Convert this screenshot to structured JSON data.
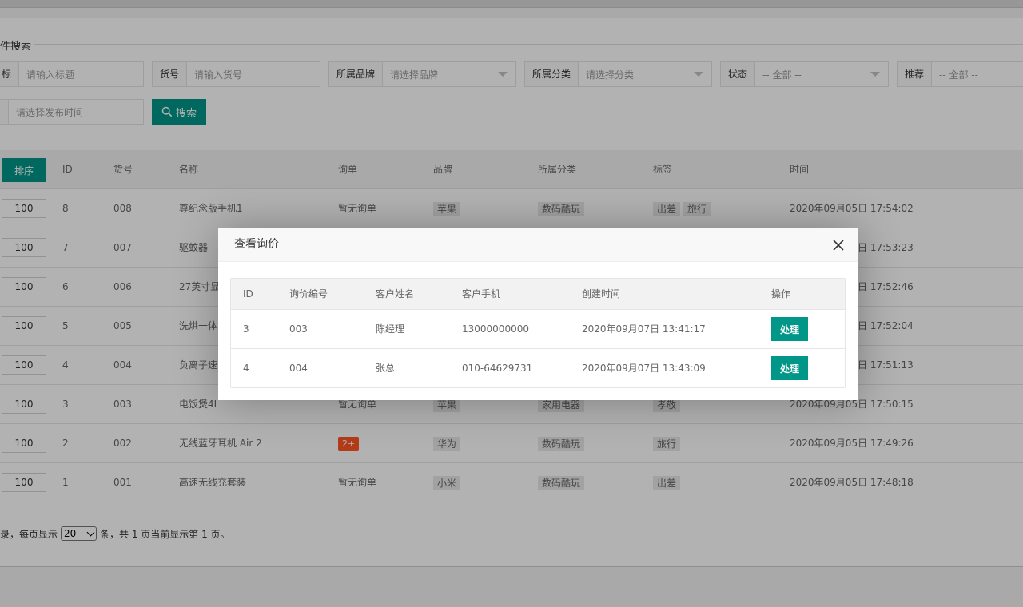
{
  "search": {
    "legend": "件搜索",
    "fields": [
      {
        "label": "标",
        "placeholder": "请输入标题",
        "type": "text"
      },
      {
        "label": "货号",
        "placeholder": "请输入货号",
        "type": "text"
      },
      {
        "label": "所属品牌",
        "placeholder": "请选择品牌",
        "type": "select"
      },
      {
        "label": "所属分类",
        "placeholder": "请选择分类",
        "type": "select"
      },
      {
        "label": "状态",
        "placeholder": "-- 全部 --",
        "type": "select"
      },
      {
        "label": "推荐",
        "placeholder": "-- 全部 --",
        "type": "select"
      }
    ],
    "time_placeholder": "请选择发布时间",
    "search_button": "搜索"
  },
  "table": {
    "sort_button": "排序",
    "headers": [
      "ID",
      "货号",
      "名称",
      "询单",
      "品牌",
      "所属分类",
      "标签",
      "时间"
    ],
    "rows": [
      {
        "sort": "100",
        "id": "8",
        "sku": "008",
        "name": "尊纪念版手机1",
        "inquiry": "暂无询单",
        "brand": "苹果",
        "category": "数码酷玩",
        "tags": [
          "出差",
          "旅行"
        ],
        "time": "2020年09月05日 17:54:02"
      },
      {
        "sort": "100",
        "id": "7",
        "sku": "007",
        "name": "驱蚊器",
        "inquiry": "",
        "brand": "",
        "category": "",
        "tags": [],
        "time": "日 17:53:23"
      },
      {
        "sort": "100",
        "id": "6",
        "sku": "006",
        "name": "27英寸显",
        "inquiry": "",
        "brand": "",
        "category": "",
        "tags": [],
        "time": "日 17:52:46"
      },
      {
        "sort": "100",
        "id": "5",
        "sku": "005",
        "name": "洗烘一体",
        "inquiry": "",
        "brand": "",
        "category": "",
        "tags": [],
        "time": "日 17:52:04"
      },
      {
        "sort": "100",
        "id": "4",
        "sku": "004",
        "name": "负离子速",
        "inquiry": "",
        "brand": "",
        "category": "",
        "tags": [],
        "time": "日 17:51:13"
      },
      {
        "sort": "100",
        "id": "3",
        "sku": "003",
        "name": "电饭煲4L",
        "inquiry": "暂无询单",
        "brand": "苹果",
        "category": "家用电器",
        "tags": [
          "孝敬"
        ],
        "time": "2020年09月05日 17:50:15"
      },
      {
        "sort": "100",
        "id": "2",
        "sku": "002",
        "name": "无线蓝牙耳机 Air 2",
        "inquiry_badge": "2+",
        "brand": "华为",
        "category": "数码酷玩",
        "tags": [
          "旅行"
        ],
        "time": "2020年09月05日 17:49:26"
      },
      {
        "sort": "100",
        "id": "1",
        "sku": "001",
        "name": "高速无线充套装",
        "inquiry": "暂无询单",
        "brand": "小米",
        "category": "数码酷玩",
        "tags": [
          "出差"
        ],
        "time": "2020年09月05日 17:48:18"
      }
    ]
  },
  "pager": {
    "prefix": "录，每页显示",
    "page_size": "20",
    "suffix": "条，共 1 页当前显示第 1 页。"
  },
  "modal": {
    "title": "查看询价",
    "headers": [
      "ID",
      "询价编号",
      "客户姓名",
      "客户手机",
      "创建时间",
      "操作"
    ],
    "rows": [
      {
        "id": "3",
        "code": "003",
        "name": "陈经理",
        "phone": "13000000000",
        "created": "2020年09月07日 13:41:17",
        "action": "处理"
      },
      {
        "id": "4",
        "code": "004",
        "name": "张总",
        "phone": "010-64629731",
        "created": "2020年09月07日 13:43:09",
        "action": "处理"
      }
    ]
  },
  "colors": {
    "primary": "#009688",
    "danger": "#ff5722"
  }
}
